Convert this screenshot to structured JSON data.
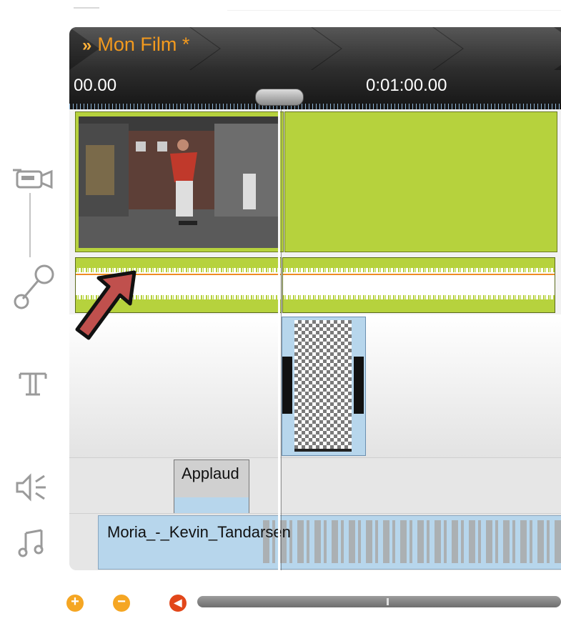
{
  "project": {
    "title": "Mon Film *",
    "title_arrows": "»"
  },
  "ruler": {
    "start_label": "00.00",
    "mid_label": "0:01:00.00"
  },
  "tracks": {
    "sound_effect_clip": "Applaud",
    "music_clip": "Moria_-_Kevin_Tandarsen"
  },
  "colors": {
    "video_clip": "#b6d23d",
    "audio_clip": "#b7d6ec",
    "title_accent": "#f39a1e",
    "arrow": "#c0504d"
  },
  "icons": {
    "video_track": "video-camera-icon",
    "audio_track": "microphone-icon",
    "title_track": "text-icon",
    "effects_track": "speaker-icon",
    "music_track": "music-note-icon",
    "zoom_in": "plus-circle-icon",
    "zoom_out": "minus-circle-icon",
    "rewind": "play-back-icon"
  }
}
